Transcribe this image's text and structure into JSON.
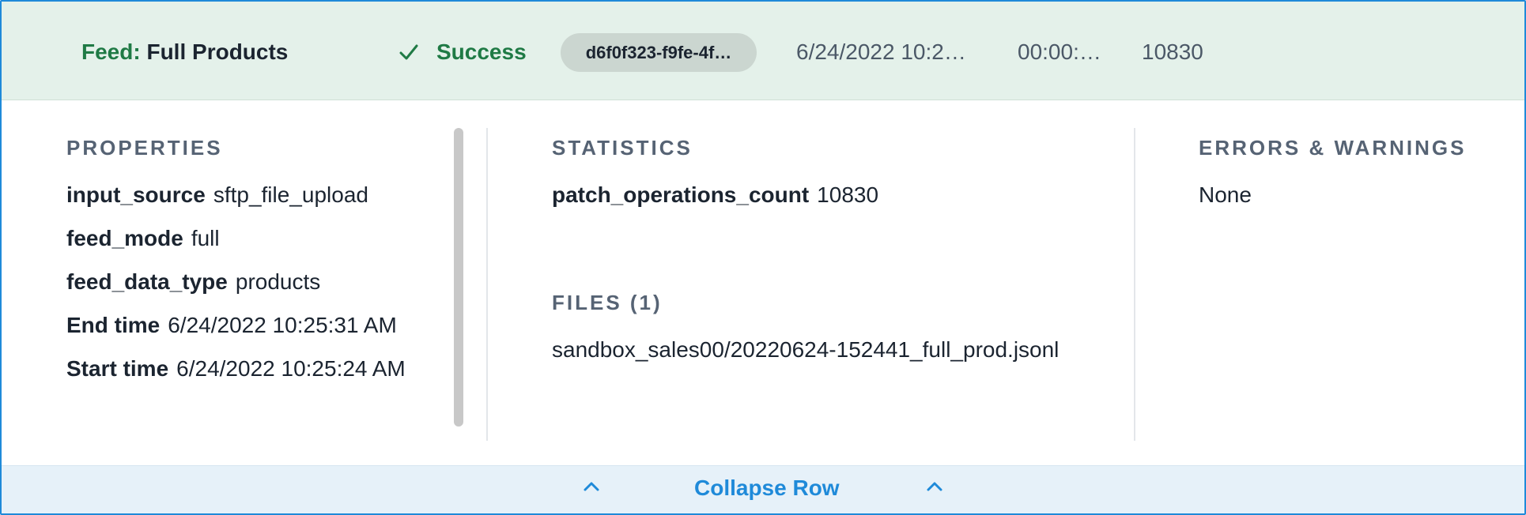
{
  "header": {
    "feed_label": "Feed:",
    "feed_name": "Full Products",
    "status": "Success",
    "status_color": "#1f7a45",
    "id_truncated": "d6f0f323-f9fe-4f…",
    "date": "6/24/2022 10:2…",
    "duration": "00:00:…",
    "count": "10830"
  },
  "properties": {
    "title": "PROPERTIES",
    "items": [
      {
        "key": "input_source",
        "value": "sftp_file_upload"
      },
      {
        "key": "feed_mode",
        "value": "full"
      },
      {
        "key": "feed_data_type",
        "value": "products"
      },
      {
        "key": "End time",
        "value": "6/24/2022 10:25:31 AM"
      },
      {
        "key": "Start time",
        "value": "6/24/2022 10:25:24 AM"
      }
    ]
  },
  "statistics": {
    "title": "STATISTICS",
    "items": [
      {
        "key": "patch_operations_count",
        "value": "10830"
      }
    ]
  },
  "files": {
    "title": "FILES (1)",
    "items": [
      "sandbox_sales00/20220624-152441_full_prod.jsonl"
    ]
  },
  "errors": {
    "title": "ERRORS & WARNINGS",
    "value": "None"
  },
  "footer": {
    "collapse_label": "Collapse Row",
    "accent_color": "#1f8ad9"
  },
  "icons": {
    "status": "check-icon",
    "collapse": "chevron-up-icon"
  }
}
